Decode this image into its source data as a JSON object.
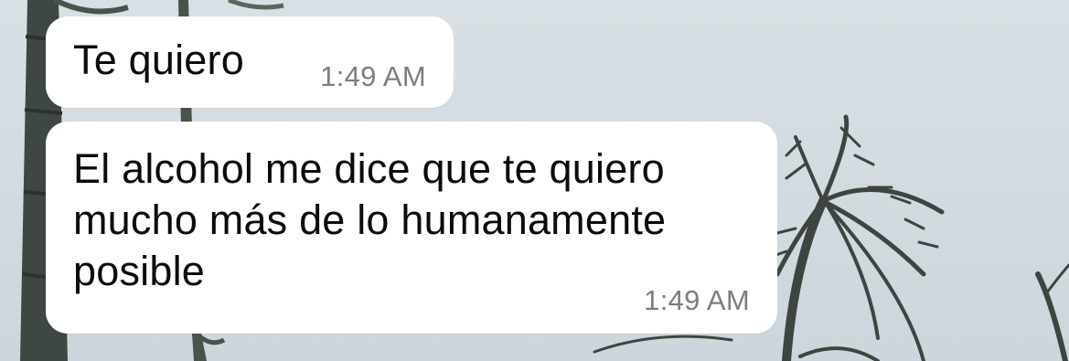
{
  "messages": [
    {
      "text": "Te quiero",
      "time": "1:49 AM"
    },
    {
      "text": "El alcohol me dice que te quiero\nmucho más de lo humanamente\nposible",
      "time": "1:49 AM"
    }
  ],
  "colors": {
    "sky": "#d3dbe0",
    "bubble": "#ffffff",
    "text": "#0b0b0b",
    "timestamp": "#7d7d82"
  }
}
